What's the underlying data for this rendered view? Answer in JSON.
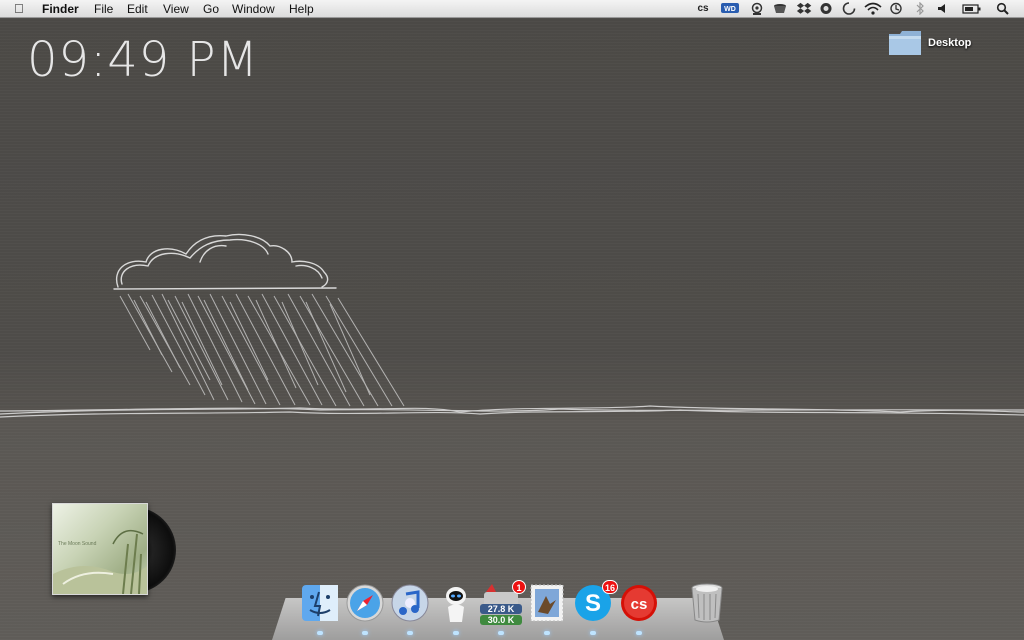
{
  "menubar": {
    "app_name": "Finder",
    "items": [
      "File",
      "Edit",
      "View",
      "Go",
      "Window",
      "Help"
    ],
    "status_icons": [
      "lastfm-icon",
      "wd-icon",
      "webcam-icon",
      "coffee-cup-icon",
      "dropbox-icon",
      "ichat-icon",
      "sync-circle-icon",
      "wifi-icon",
      "bluetooth-icon",
      "time-machine-icon",
      "volume-icon",
      "battery-icon",
      "spotlight-icon"
    ]
  },
  "clock": {
    "time": "09:49 PM"
  },
  "desktop_folder": {
    "label": "Desktop"
  },
  "album": {
    "tiny_title": "The Moon Sound"
  },
  "dock": {
    "items": [
      {
        "name": "finder",
        "running": true
      },
      {
        "name": "safari",
        "running": true
      },
      {
        "name": "itunes",
        "running": true
      },
      {
        "name": "eve-robot",
        "running": true
      },
      {
        "name": "transmission",
        "running": true,
        "badge": "1",
        "stat_up": "27.8 K",
        "stat_down": "30.0 K"
      },
      {
        "name": "mail",
        "running": true
      },
      {
        "name": "skype",
        "running": true,
        "badge": "16"
      },
      {
        "name": "lastfm",
        "running": true
      },
      {
        "name": "trash",
        "running": false
      }
    ]
  },
  "colors": {
    "wallpaper": "#4b4946",
    "clock_text": "#e6e6e6",
    "badge_red": "#e11111",
    "skype_blue": "#1aa3e8",
    "lastfm_red": "#d51007"
  }
}
